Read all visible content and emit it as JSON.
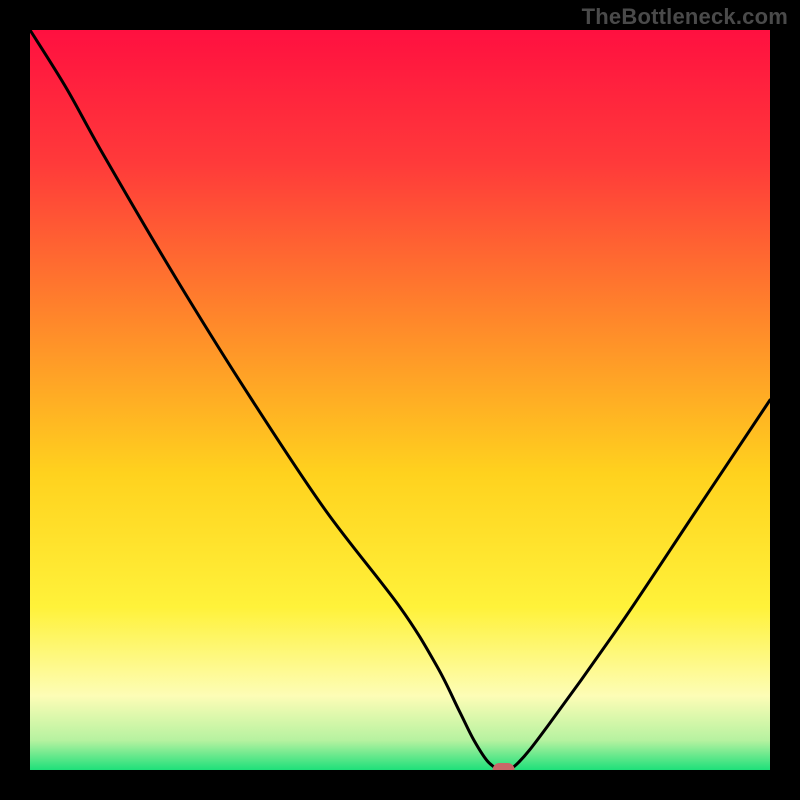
{
  "watermark": "TheBottleneck.com",
  "chart_data": {
    "type": "line",
    "title": "",
    "xlabel": "",
    "ylabel": "",
    "xlim": [
      0,
      100
    ],
    "ylim": [
      0,
      100
    ],
    "x": [
      0,
      5,
      10,
      20,
      30,
      40,
      50,
      55,
      58,
      60,
      62,
      64,
      66,
      70,
      80,
      90,
      100
    ],
    "values": [
      100,
      92,
      83,
      66,
      50,
      35,
      22,
      14,
      8,
      4,
      1,
      0,
      1,
      6,
      20,
      35,
      50
    ],
    "marker": {
      "x": 64,
      "y": 0,
      "shape": "pill",
      "color": "#c86868"
    },
    "background": {
      "type": "vertical-gradient",
      "stops": [
        {
          "pos": 0.0,
          "color": "#ff1040"
        },
        {
          "pos": 0.18,
          "color": "#ff3a3a"
        },
        {
          "pos": 0.4,
          "color": "#ff8a2a"
        },
        {
          "pos": 0.6,
          "color": "#ffd21e"
        },
        {
          "pos": 0.78,
          "color": "#fff23a"
        },
        {
          "pos": 0.9,
          "color": "#fdfdb6"
        },
        {
          "pos": 0.96,
          "color": "#b6f2a0"
        },
        {
          "pos": 1.0,
          "color": "#1ee07a"
        }
      ]
    }
  }
}
